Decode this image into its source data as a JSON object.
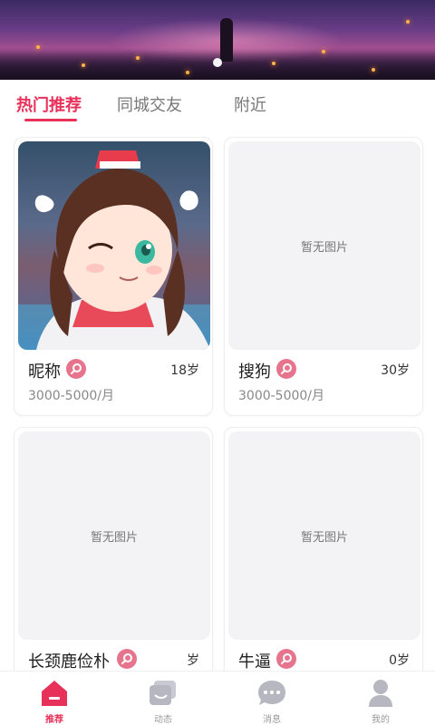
{
  "banner": {
    "active_index": 0,
    "image": "night-sky-fireflies-girl-illustration"
  },
  "tabs": [
    {
      "label": "热门推荐",
      "active": true
    },
    {
      "label": "同城交友",
      "active": false
    },
    {
      "label": "附近",
      "active": false
    }
  ],
  "cards": [
    {
      "name": "昵称",
      "age": "18岁",
      "salary": "3000-5000/月",
      "photo": "anime-girl-winking",
      "placeholder": ""
    },
    {
      "name": "搜狗",
      "age": "30岁",
      "salary": "3000-5000/月",
      "photo": "",
      "placeholder": "暂无图片"
    },
    {
      "name": "长颈鹿俭朴",
      "age": "岁",
      "salary": "",
      "photo": "",
      "placeholder": "暂无图片"
    },
    {
      "name": "牛逼",
      "age": "0岁",
      "salary": "",
      "photo": "",
      "placeholder": "暂无图片"
    }
  ],
  "badge_icon": "search-magnifier-icon",
  "bottom_nav": [
    {
      "label": "推荐",
      "icon": "home-icon",
      "active": true
    },
    {
      "label": "动态",
      "icon": "feed-icon",
      "active": false
    },
    {
      "label": "消息",
      "icon": "chat-icon",
      "active": false
    },
    {
      "label": "我的",
      "icon": "user-icon",
      "active": false
    }
  ],
  "colors": {
    "accent": "#e8315a",
    "badge": "#e7748d",
    "placeholder_bg": "#f3f3f5",
    "nav_inactive": "#b7b7c2"
  }
}
